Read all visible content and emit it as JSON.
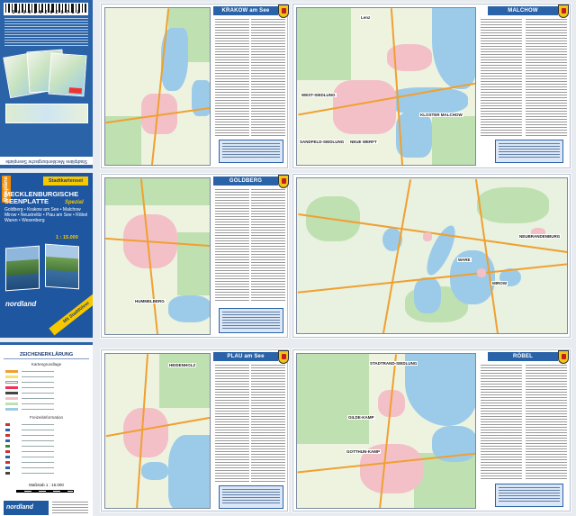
{
  "strip_top": {
    "barcode_text": "I·H·J·K·L·8·Z·6·Z·S·7·I·Z",
    "spine_text": "Stadtpläne Mecklenburgische Seenplatte"
  },
  "cover": {
    "badge": "Ortspläne",
    "stadtkartenset": "Stadtkartenset",
    "title": "MECKLENBURGISCHE SEENPLATTE",
    "spezial": "Spezial",
    "towns": "Goldberg • Krakow am See • Malchow Mirow • Neustrelitz • Plau am See • Röbel Waren • Wesenberg",
    "scale": "1 : 15.000",
    "brand": "nordland",
    "ribbon": "Mit Stadtführer"
  },
  "legend": {
    "title": "ZEICHENERKLÄRUNG",
    "section1": "Kartengrundlage",
    "section2": "Freizeitinformation",
    "massstab": "Maßstab 1 : 15.000",
    "brand": "nordland"
  },
  "panels": {
    "krakow": {
      "title": "KRAKOW am See"
    },
    "malchow": {
      "title": "MALCHOW",
      "labels": [
        "WEST-SIEDLUNG",
        "KLOSTER MALCHOW",
        "SANDFELD-SIEDLUNG",
        "NEUE WERFT",
        "Lenz"
      ]
    },
    "goldberg": {
      "title": "GOLDBERG",
      "labels": [
        "HUMMELBERG"
      ]
    },
    "overview": {
      "labels": [
        "NEUBRANDENBURG",
        "WARE",
        "MIROW"
      ]
    },
    "plau": {
      "title": "PLAU am See",
      "labels": [
        "HEIDENHOLZ"
      ]
    },
    "robel": {
      "title": "RÖBEL",
      "labels": [
        "STADTRAND-SIEDLUNG",
        "GOTTHUN-KAMP",
        "GILDE-KAMP"
      ]
    }
  },
  "colors": {
    "brand_blue": "#2a63a8",
    "accent_yellow": "#f6c800",
    "accent_orange": "#f28c00",
    "water": "#9ccbe9",
    "forest": "#bfe0b0",
    "settlement": "#f3c0c8",
    "road": "#f0a030"
  }
}
